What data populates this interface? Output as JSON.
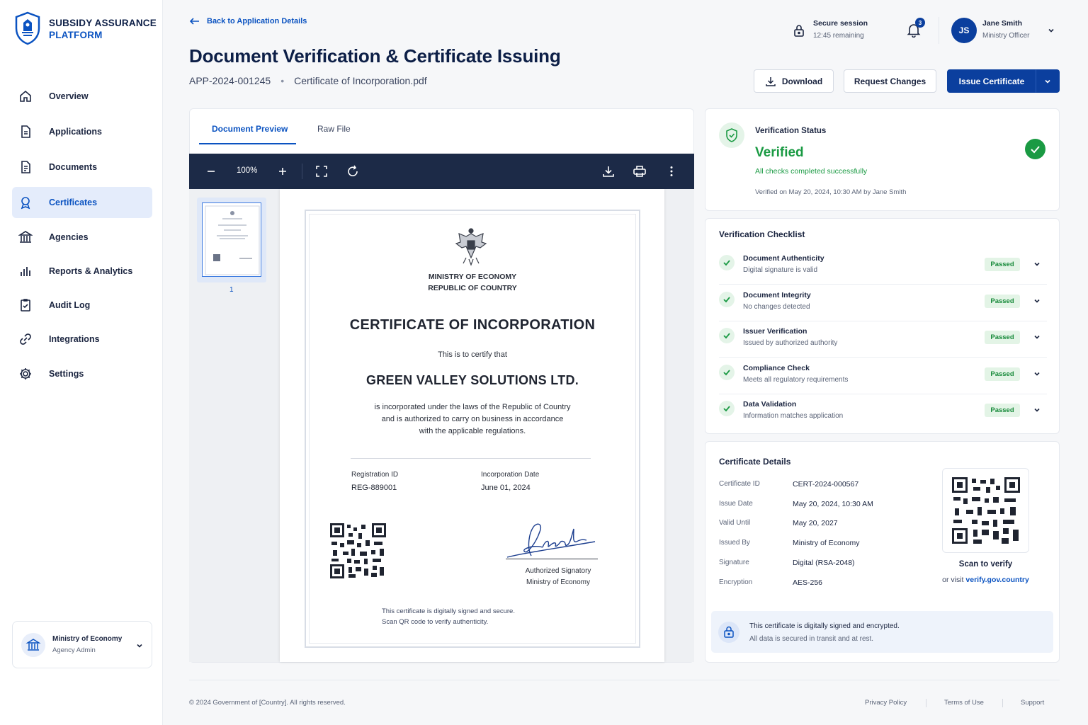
{
  "brand": {
    "line1": "SUBSIDY ASSURANCE",
    "line2": "PLATFORM"
  },
  "sidebar": {
    "items": [
      {
        "label": "Overview",
        "icon": "home-icon"
      },
      {
        "label": "Applications",
        "icon": "file-text-icon"
      },
      {
        "label": "Documents",
        "icon": "document-icon"
      },
      {
        "label": "Certificates",
        "icon": "badge-icon",
        "active": true
      },
      {
        "label": "Agencies",
        "icon": "building-icon"
      },
      {
        "label": "Reports & Analytics",
        "icon": "bar-chart-icon"
      },
      {
        "label": "Audit Log",
        "icon": "clipboard-check-icon"
      },
      {
        "label": "Integrations",
        "icon": "link-icon"
      },
      {
        "label": "Settings",
        "icon": "gear-icon"
      }
    ],
    "org": {
      "name": "Ministry of Economy",
      "role": "Agency Admin"
    }
  },
  "header": {
    "back_label": "Back to Application Details",
    "title": "Document Verification & Certificate Issuing",
    "app_id": "APP-2024-001245",
    "separator": "•",
    "file_name": "Certificate of Incorporation.pdf",
    "session_title": "Secure session",
    "session_time": "12:45 remaining",
    "notif_count": "3",
    "user": {
      "initials": "JS",
      "name": "Jane Smith",
      "role": "Ministry Officer"
    },
    "download_label": "Download",
    "request_label": "Request Changes",
    "issue_label": "Issue Certificate"
  },
  "preview": {
    "tabs": [
      "Document Preview",
      "Raw File"
    ],
    "zoom": "100%",
    "thumb_page": "1"
  },
  "certificate": {
    "ministry_line1": "MINISTRY OF ECONOMY",
    "ministry_line2": "REPUBLIC OF COUNTRY",
    "title": "CERTIFICATE OF INCORPORATION",
    "certify": "This is to certify that",
    "company": "GREEN VALLEY SOLUTIONS LTD.",
    "body_line1": "is incorporated under the laws of the Republic of Country",
    "body_line2": "and is authorized to carry on business in accordance",
    "body_line3": "with the applicable regulations.",
    "reg_label": "Registration ID",
    "reg_value": "REG-889001",
    "date_label": "Incorporation Date",
    "date_value": "June 01, 2024",
    "signatory": "Authorized Signatory",
    "signatory_org": "Ministry of Economy",
    "foot_line1": "This certificate is digitally signed and secure.",
    "foot_line2": "Scan QR code to verify authenticity."
  },
  "status": {
    "title": "Verification Status",
    "value": "Verified",
    "subtitle": "All checks completed successfully",
    "meta": "Verified on May 20, 2024, 10:30 AM by Jane Smith"
  },
  "checklist": {
    "title": "Verification Checklist",
    "items": [
      {
        "title": "Document Authenticity",
        "sub": "Digital signature is valid",
        "status": "Passed"
      },
      {
        "title": "Document Integrity",
        "sub": "No changes detected",
        "status": "Passed"
      },
      {
        "title": "Issuer Verification",
        "sub": "Issued by authorized authority",
        "status": "Passed"
      },
      {
        "title": "Compliance Check",
        "sub": "Meets all regulatory requirements",
        "status": "Passed"
      },
      {
        "title": "Data Validation",
        "sub": "Information matches application",
        "status": "Passed"
      }
    ]
  },
  "details": {
    "title": "Certificate Details",
    "rows": [
      {
        "label": "Certificate ID",
        "value": "CERT-2024-000567"
      },
      {
        "label": "Issue Date",
        "value": "May 20, 2024, 10:30 AM"
      },
      {
        "label": "Valid Until",
        "value": "May 20, 2027"
      },
      {
        "label": "Issued By",
        "value": "Ministry of Economy"
      },
      {
        "label": "Signature",
        "value": "Digital (RSA-2048)"
      },
      {
        "label": "Encryption",
        "value": "AES-256"
      }
    ],
    "scan_label": "Scan to verify",
    "visit_prefix": "or visit",
    "visit_link": "verify.gov.country",
    "secure_line1": "This certificate is digitally signed and encrypted.",
    "secure_line2": "All data is secured in transit and at rest."
  },
  "footer": {
    "copyright": "© 2024 Government of [Country]. All rights reserved.",
    "links": [
      "Privacy Policy",
      "Terms of Use",
      "Support"
    ]
  },
  "colors": {
    "accent": "#0b53c1",
    "primary_button": "#0b3f9e",
    "success": "#1a9a43",
    "toolbar": "#1c2a47"
  }
}
